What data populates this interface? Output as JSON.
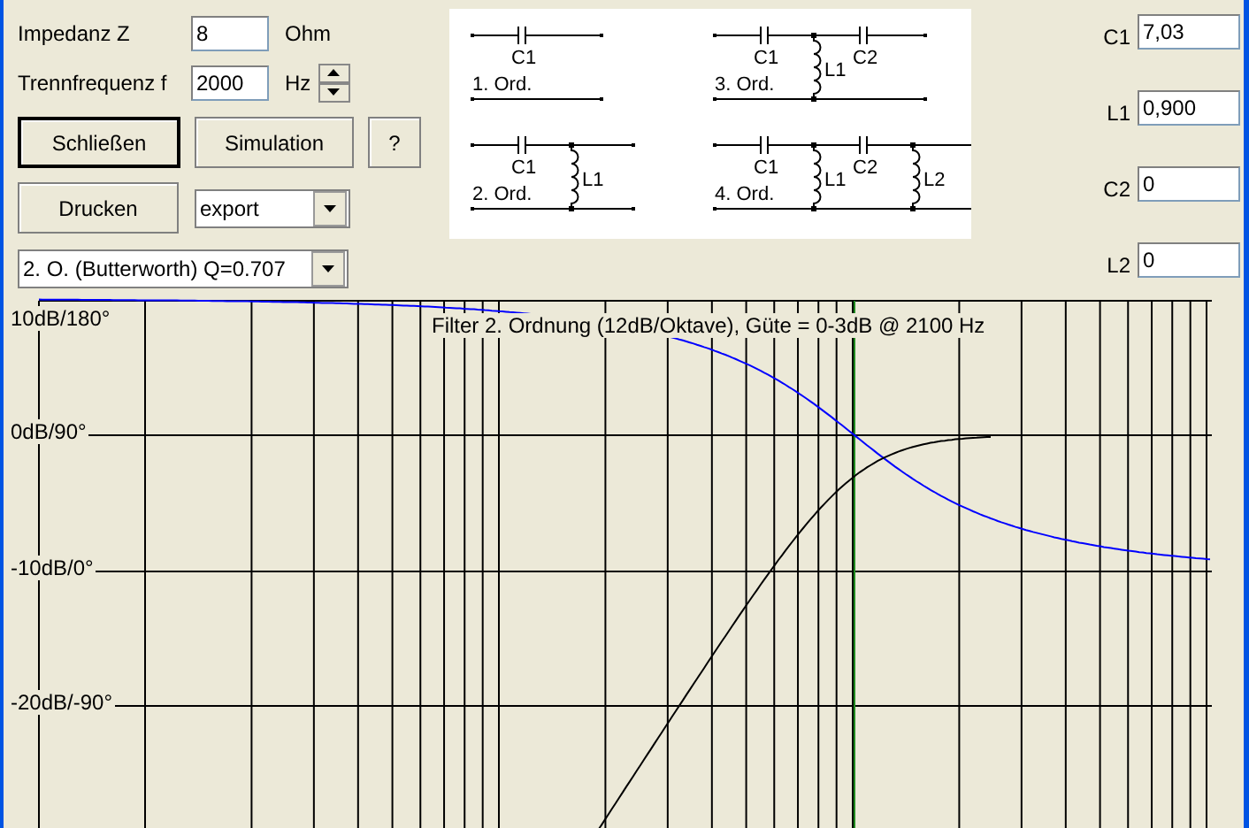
{
  "fields": [
    {
      "label": "Impedanz Z",
      "value": "8",
      "unit": "Ohm"
    },
    {
      "label": "Trennfrequenz f",
      "value": "2000",
      "unit": "Hz",
      "spinner": true
    }
  ],
  "buttons": [
    {
      "label": "Schließen",
      "default": true
    },
    {
      "label": "Simulation",
      "default": false
    },
    {
      "label": "?",
      "default": false
    }
  ],
  "print_button": {
    "label": "Drucken",
    "default": false
  },
  "export_select": {
    "value": "export"
  },
  "filter_select": {
    "value": "2. O. (Butterworth) Q=0.707"
  },
  "schematics": [
    {
      "label": "1. Ord.",
      "components": [
        {
          "kind": "capacitor",
          "label": "C1"
        }
      ]
    },
    {
      "label": "3. Ord.",
      "components": [
        {
          "kind": "capacitor",
          "label": "C1"
        },
        {
          "kind": "inductor",
          "label": "L1"
        },
        {
          "kind": "capacitor",
          "label": "C2"
        }
      ]
    },
    {
      "label": "2. Ord.",
      "components": [
        {
          "kind": "capacitor",
          "label": "C1"
        },
        {
          "kind": "inductor",
          "label": "L1"
        }
      ]
    },
    {
      "label": "4. Ord.",
      "components": [
        {
          "kind": "capacitor",
          "label": "C1"
        },
        {
          "kind": "inductor",
          "label": "L1"
        },
        {
          "kind": "capacitor",
          "label": "C2"
        },
        {
          "kind": "inductor",
          "label": "L2"
        }
      ]
    }
  ],
  "component_values": [
    {
      "label": "C1",
      "value": "7,03"
    },
    {
      "label": "L1",
      "value": "0,900"
    },
    {
      "label": "C2",
      "value": "0"
    },
    {
      "label": "L2",
      "value": "0"
    }
  ],
  "chart": {
    "title": "Filter 2. Ordnung (12dB/Oktave), Güte = 0-3dB @ 2100 Hz",
    "y_labels": [
      "10dB/180°",
      "0dB/90°",
      "-10dB/0°",
      "-20dB/-90°"
    ]
  }
}
